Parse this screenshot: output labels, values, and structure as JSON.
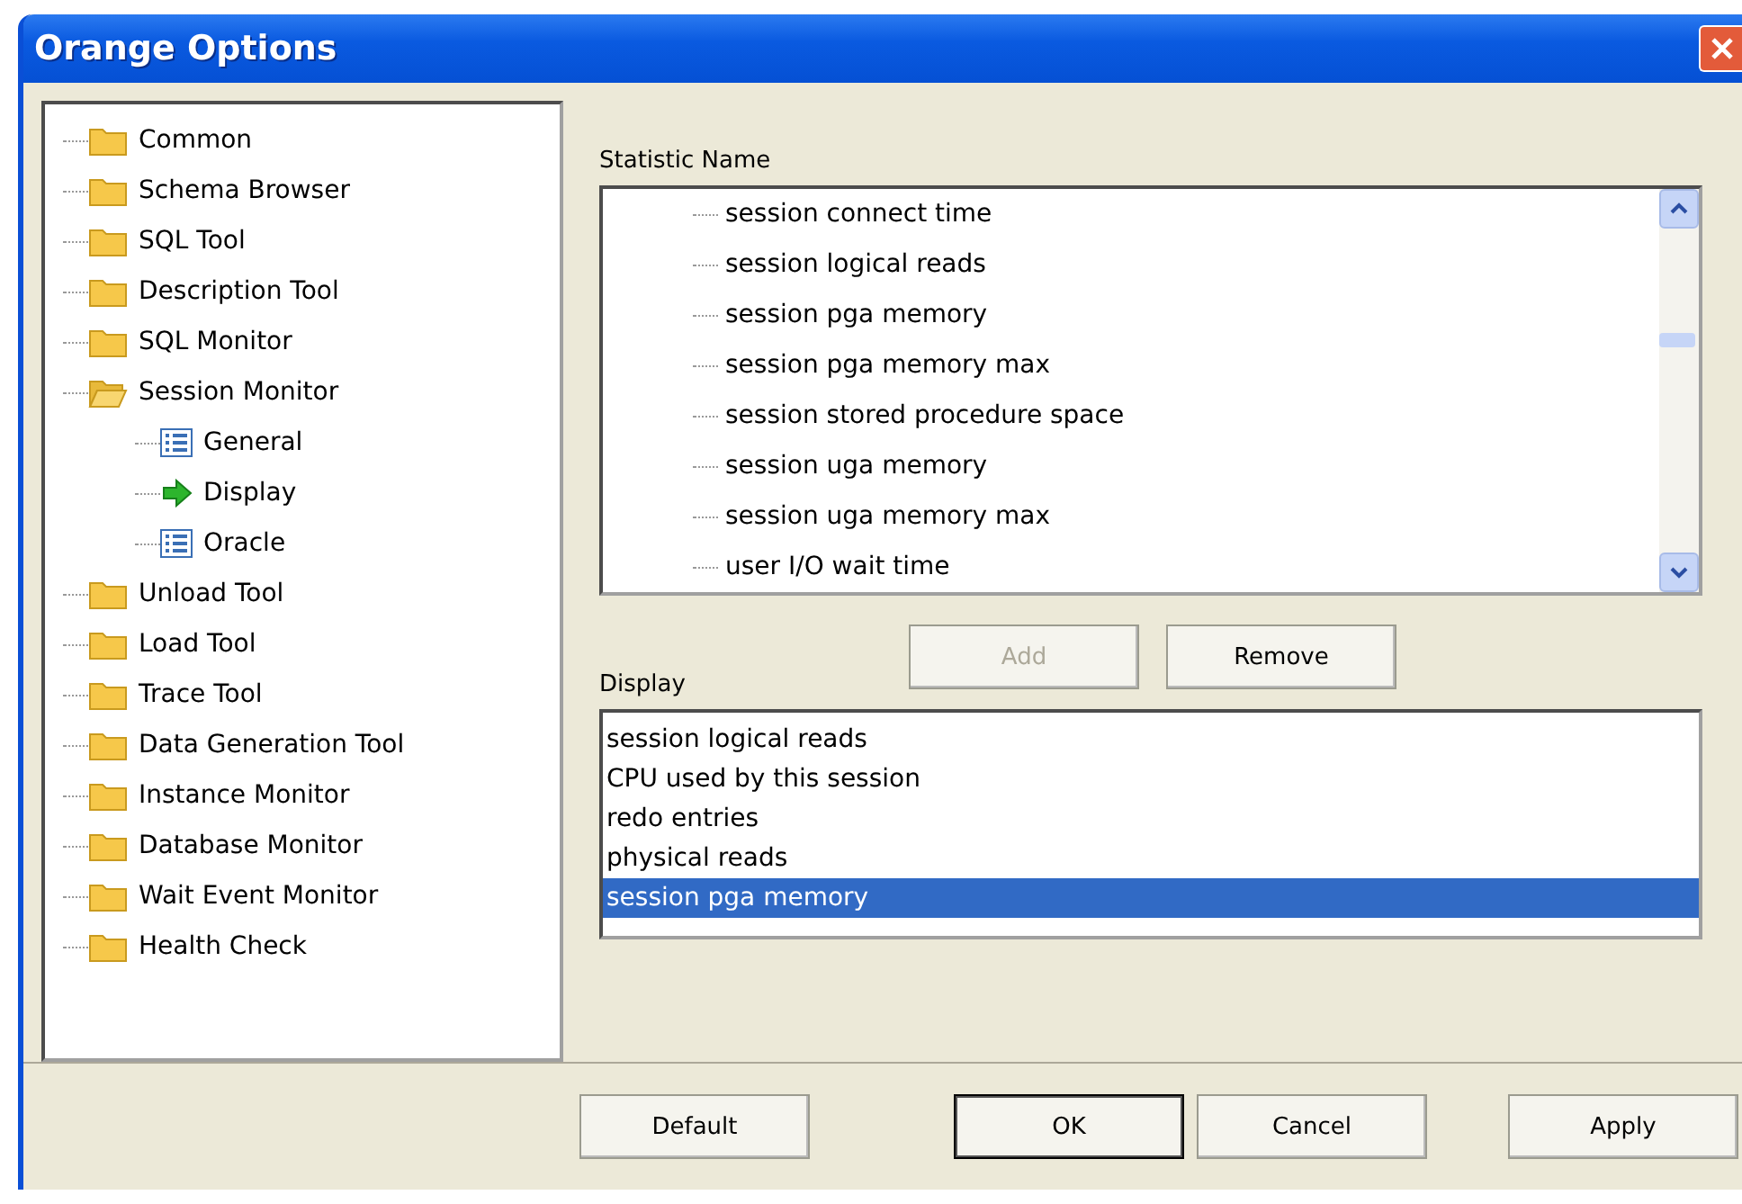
{
  "window": {
    "title": "Orange Options"
  },
  "tree": [
    {
      "label": "Common",
      "kind": "folder"
    },
    {
      "label": "Schema Browser",
      "kind": "folder"
    },
    {
      "label": "SQL Tool",
      "kind": "folder"
    },
    {
      "label": "Description Tool",
      "kind": "folder"
    },
    {
      "label": "SQL Monitor",
      "kind": "folder"
    },
    {
      "label": "Session Monitor",
      "kind": "folder-open",
      "children": [
        {
          "label": "General",
          "kind": "list"
        },
        {
          "label": "Display",
          "kind": "arrow"
        },
        {
          "label": "Oracle",
          "kind": "list"
        }
      ]
    },
    {
      "label": "Unload Tool",
      "kind": "folder"
    },
    {
      "label": "Load Tool",
      "kind": "folder"
    },
    {
      "label": "Trace Tool",
      "kind": "folder"
    },
    {
      "label": "Data Generation Tool",
      "kind": "folder"
    },
    {
      "label": "Instance Monitor",
      "kind": "folder"
    },
    {
      "label": "Database Monitor",
      "kind": "folder"
    },
    {
      "label": "Wait Event Monitor",
      "kind": "folder"
    },
    {
      "label": "Health Check",
      "kind": "folder"
    }
  ],
  "statistic_name": {
    "label": "Statistic Name",
    "items": [
      "session connect time",
      "session logical reads",
      "session pga memory",
      "session pga memory max",
      "session stored procedure space",
      "session uga memory",
      "session uga memory max",
      "user I/O wait time"
    ]
  },
  "list_buttons": [
    {
      "label": "Add",
      "disabled": true
    },
    {
      "label": "Remove",
      "disabled": false
    }
  ],
  "display": {
    "label": "Display",
    "items": [
      {
        "label": "session logical reads",
        "selected": false
      },
      {
        "label": "CPU used by this session",
        "selected": false
      },
      {
        "label": "redo entries",
        "selected": false
      },
      {
        "label": "physical reads",
        "selected": false
      },
      {
        "label": "session pga memory",
        "selected": true
      }
    ]
  },
  "buttons": [
    {
      "label": "Default",
      "default": false
    },
    {
      "label": "OK",
      "default": true
    },
    {
      "label": "Cancel",
      "default": false
    },
    {
      "label": "Apply",
      "default": false
    }
  ]
}
